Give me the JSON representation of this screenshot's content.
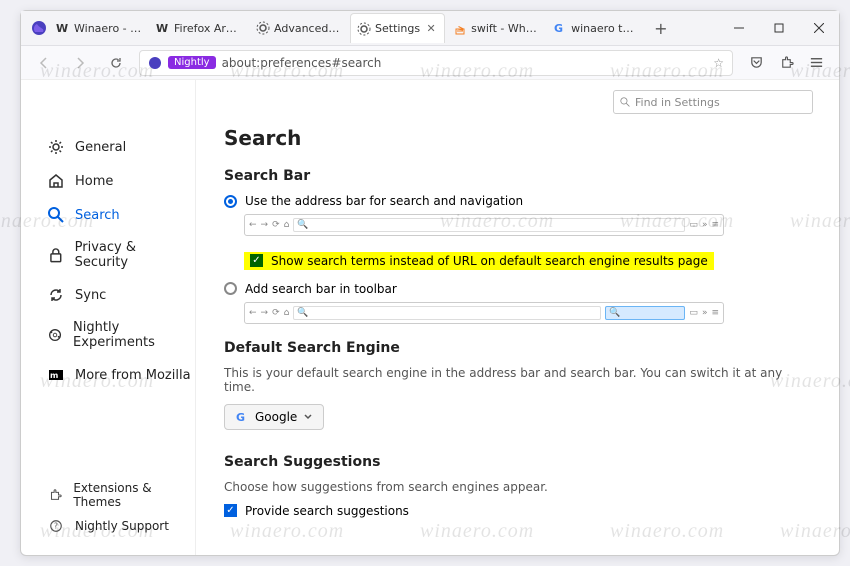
{
  "watermark": "winaero.com",
  "browser_name": "Nightly",
  "urlbar": {
    "url": "about:preferences#search"
  },
  "tabs": [
    {
      "label": "Winaero - At th"
    },
    {
      "label": "Firefox Archive"
    },
    {
      "label": "Advanced Pref"
    },
    {
      "label": "Settings",
      "active": true
    },
    {
      "label": "swift - Why is a"
    },
    {
      "label": "winaero tweak"
    }
  ],
  "sidebar": {
    "items": [
      {
        "label": "General",
        "icon": "gear"
      },
      {
        "label": "Home",
        "icon": "home"
      },
      {
        "label": "Search",
        "icon": "search",
        "active": true
      },
      {
        "label": "Privacy & Security",
        "icon": "lock"
      },
      {
        "label": "Sync",
        "icon": "sync"
      },
      {
        "label": "Nightly Experiments",
        "icon": "flask"
      },
      {
        "label": "More from Mozilla",
        "icon": "mozilla"
      }
    ],
    "bottom": [
      {
        "label": "Extensions & Themes",
        "icon": "puzzle"
      },
      {
        "label": "Nightly Support",
        "icon": "help"
      }
    ]
  },
  "find_placeholder": "Find in Settings",
  "page": {
    "title": "Search",
    "searchbar": {
      "heading": "Search Bar",
      "opt_url": "Use the address bar for search and navigation",
      "opt_show_terms": "Show search terms instead of URL on default search engine results page",
      "opt_separate": "Add search bar in toolbar"
    },
    "default_engine": {
      "heading": "Default Search Engine",
      "desc": "This is your default search engine in the address bar and search bar. You can switch it at any time.",
      "current": "Google"
    },
    "suggestions": {
      "heading": "Search Suggestions",
      "desc": "Choose how suggestions from search engines appear.",
      "provide": "Provide search suggestions"
    }
  }
}
